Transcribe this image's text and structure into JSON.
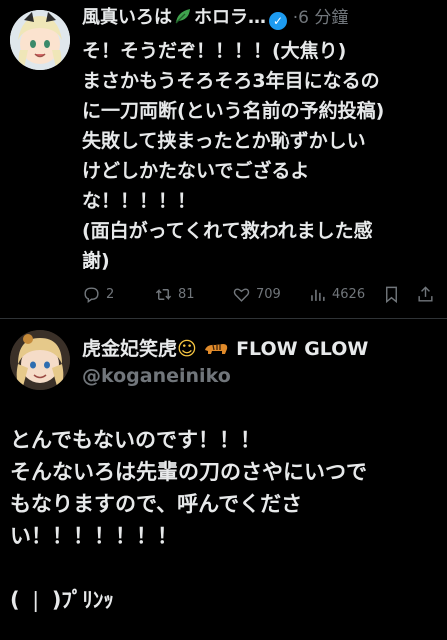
{
  "tweet": {
    "author_name": "風真いろは",
    "author_name_suffix": "ホロラ…",
    "time_sep": "·",
    "time": "6 分鐘",
    "lines": [
      "そ！そうだぞ！！！！(大焦り)",
      "まさかもうそろそろ3年目になるの",
      "に一刀両断(という名前の予約投稿)",
      "失敗して挟まったとか恥ずかしい",
      "けどしかたないでござるよ",
      "な！！！！！",
      "(面白がってくれて救われました感",
      "謝)"
    ],
    "stats": {
      "replies": "2",
      "retweets": "81",
      "likes": "709",
      "views": "4626"
    },
    "icons": [
      "leaf-icon",
      "verified-badge-icon",
      "reply-icon",
      "retweet-icon",
      "like-icon",
      "views-icon",
      "bookmark-icon",
      "share-icon"
    ]
  },
  "quoted": {
    "author_name": "虎金妃笑虎",
    "author_name_emoji": "☺",
    "author_name_suffix": "FLOW GLOW",
    "handle": "@koganeiniko",
    "lines": [
      "とんでもないのです！！！",
      "そんないろは先輩の刀のさやにいつで",
      "もなりますので、呼んでくださ",
      "い！！！！！！！"
    ],
    "closing": "( ❘ )ﾌﾟﾘﾝｯ"
  },
  "colors": {
    "background": "#000000",
    "text": "#e7e9ea",
    "muted": "#71767b",
    "verified": "#1d9bf0",
    "divider": "#2f3336"
  }
}
